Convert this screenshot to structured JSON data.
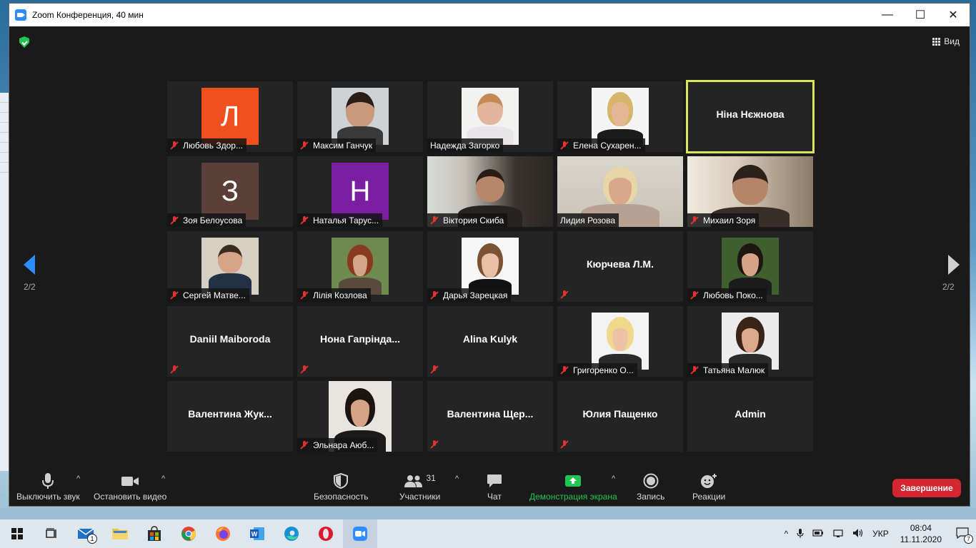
{
  "window": {
    "title": "Zoom Конференция, 40 мин",
    "controls": {
      "minimize": "—",
      "maximize": "☐",
      "close": "✕"
    }
  },
  "header": {
    "view_label": "Вид",
    "security_icon": "shield-check-icon"
  },
  "navigation": {
    "page_left": "2/2",
    "page_right": "2/2"
  },
  "participants": [
    {
      "name": "Любовь Здор...",
      "type": "letter",
      "letter": "Л",
      "color": "#f0501e",
      "muted": true
    },
    {
      "name": "Максим Ганчук",
      "type": "photo",
      "muted": true
    },
    {
      "name": "Надежда Загорко",
      "type": "photo",
      "muted": false
    },
    {
      "name": "Елена Сухарен...",
      "type": "photo",
      "muted": true
    },
    {
      "name": "Ніна Нєжнова",
      "type": "name",
      "active": true,
      "muted": false
    },
    {
      "name": "Зоя Белоусова",
      "type": "letter",
      "letter": "З",
      "color": "#5a4038",
      "muted": true
    },
    {
      "name": "Наталья Тарус...",
      "type": "letter",
      "letter": "Н",
      "color": "#7b1fa2",
      "muted": true
    },
    {
      "name": "Віктория Скиба",
      "type": "video",
      "muted": true
    },
    {
      "name": "Лидия Розова",
      "type": "video",
      "muted": false
    },
    {
      "name": "Михаил Зоря",
      "type": "video",
      "muted": true
    },
    {
      "name": "Сергей Матве...",
      "type": "photo",
      "muted": true
    },
    {
      "name": "Лілія Козлова",
      "type": "photo",
      "muted": true
    },
    {
      "name": "Дарья Зарецкая",
      "type": "photo",
      "muted": true
    },
    {
      "name": "Кюрчева Л.М.",
      "type": "name",
      "muted": true
    },
    {
      "name": "Любовь Поко...",
      "type": "photo",
      "muted": true
    },
    {
      "name": "Daniil Maiboroda",
      "type": "name",
      "muted": true
    },
    {
      "name": "Нона  Гапрінда...",
      "type": "name",
      "muted": true
    },
    {
      "name": "Alina Kulyk",
      "type": "name",
      "muted": true
    },
    {
      "name": "Григоренко О...",
      "type": "photo",
      "muted": true
    },
    {
      "name": "Татьяна Малюк",
      "type": "photo",
      "muted": true
    },
    {
      "name": "Валентина  Жук...",
      "type": "name",
      "muted": false
    },
    {
      "name": "Эльнара Аюб...",
      "type": "photo",
      "muted": true
    },
    {
      "name": "Валентина  Щер...",
      "type": "name",
      "muted": true
    },
    {
      "name": "Юлия Пащенко",
      "type": "name",
      "muted": true
    },
    {
      "name": "Admin",
      "type": "name",
      "muted": false
    }
  ],
  "toolbar": {
    "mute_label": "Выключить звук",
    "video_label": "Остановить видео",
    "security_label": "Безопасность",
    "participants_label": "Участники",
    "participants_count": "31",
    "chat_label": "Чат",
    "share_label": "Демонстрация экрана",
    "record_label": "Запись",
    "reactions_label": "Реакции",
    "end_label": "Завершение",
    "caret": "^"
  },
  "taskbar": {
    "mail_badge": "1",
    "language": "УКР",
    "time": "08:04",
    "date": "11.11.2020",
    "notifications_badge": "7",
    "tray_chevron": "^"
  }
}
